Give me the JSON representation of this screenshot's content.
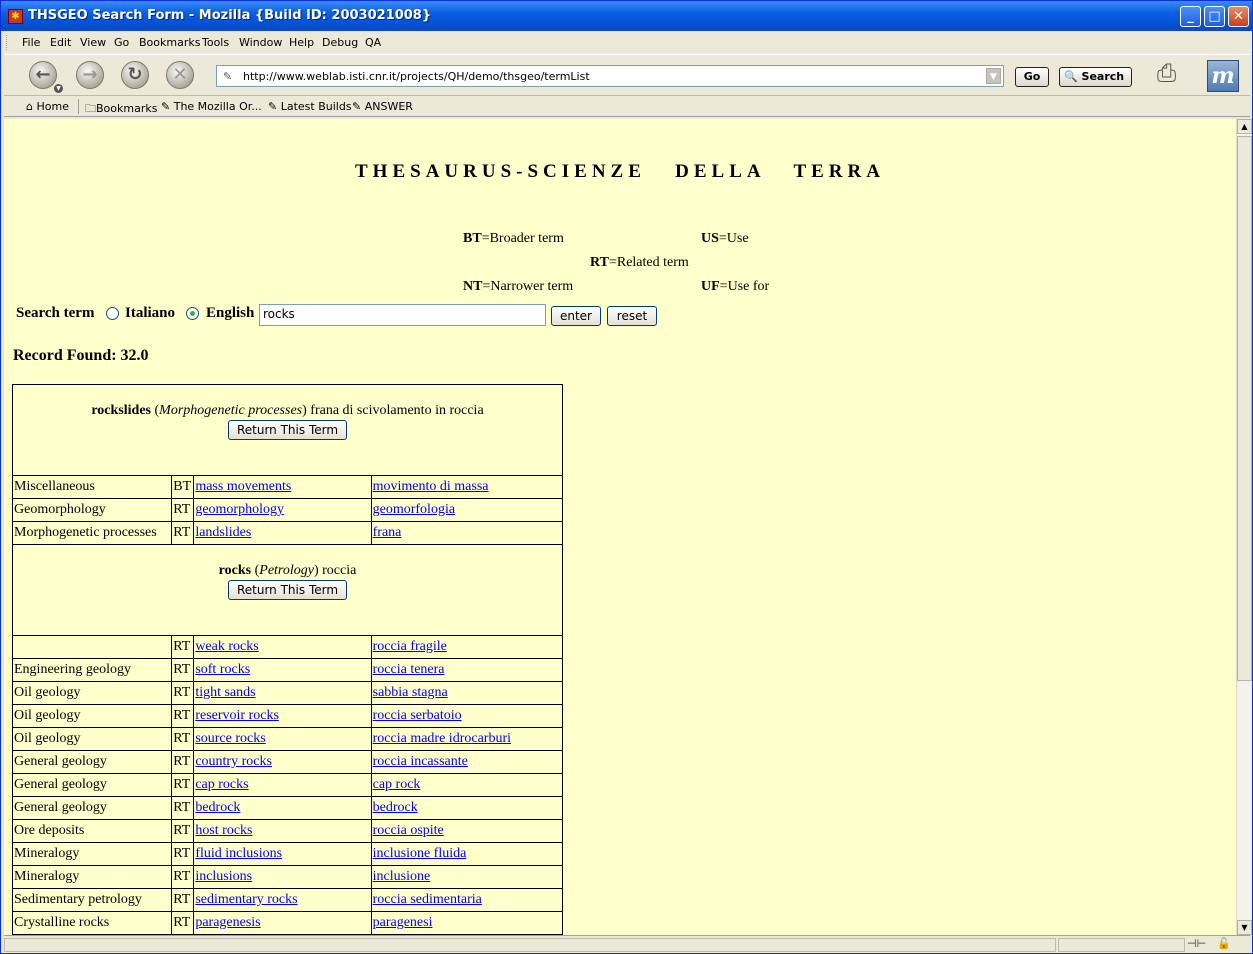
{
  "window": {
    "title": "THSGEO Search Form - Mozilla {Build ID: 2003021008}",
    "controls": [
      "minimize",
      "maximize",
      "close"
    ]
  },
  "menu": [
    "File",
    "Edit",
    "View",
    "Go",
    "Bookmarks",
    "Tools",
    "Window",
    "Help",
    "Debug",
    "QA"
  ],
  "navbar": {
    "url": "http://www.weblab.isti.cnr.it/projects/QH/demo/thsgeo/termList",
    "go_label": "Go",
    "search_label": "Search"
  },
  "bookmarks": [
    "Home",
    "Bookmarks",
    "The Mozilla Or...",
    "Latest Builds",
    "ANSWER"
  ],
  "page": {
    "title": "THESAURUS-SCIENZE   DELLA   TERRA",
    "legend": {
      "bt_abbr": "BT",
      "bt_text": "=Broader term",
      "us_abbr": "US",
      "us_text": "=Use",
      "rt_abbr": "RT",
      "rt_text": "=Related term",
      "nt_abbr": "NT",
      "nt_text": "=Narrower term",
      "uf_abbr": "UF",
      "uf_text": "=Use for"
    },
    "search": {
      "label": "Search term",
      "option_it": "Italiano",
      "option_en": "English",
      "selected": "English",
      "value": "rocks",
      "enter_label": "enter",
      "reset_label": "reset"
    },
    "record_found": "Record Found: 32.0",
    "return_label": "Return This Term",
    "groups": [
      {
        "term": "rockslides",
        "category": "Morphogenetic processes",
        "italian": "frana di scivolamento in roccia",
        "rows": [
          {
            "domain": "Miscellaneous",
            "rel": "BT",
            "en": "mass movements",
            "it": "movimento di massa"
          },
          {
            "domain": "Geomorphology",
            "rel": "RT",
            "en": "geomorphology",
            "it": "geomorfologia"
          },
          {
            "domain": "Morphogenetic processes",
            "rel": "RT",
            "en": "landslides",
            "it": "frana"
          }
        ]
      },
      {
        "term": "rocks",
        "category": "Petrology",
        "italian": "roccia",
        "rows": [
          {
            "domain": "",
            "rel": "RT",
            "en": "weak rocks",
            "it": "roccia fragile"
          },
          {
            "domain": "Engineering geology",
            "rel": "RT",
            "en": "soft rocks",
            "it": "roccia tenera"
          },
          {
            "domain": "Oil geology",
            "rel": "RT",
            "en": "tight sands",
            "it": "sabbia stagna"
          },
          {
            "domain": "Oil geology",
            "rel": "RT",
            "en": "reservoir rocks",
            "it": "roccia serbatoio"
          },
          {
            "domain": "Oil geology",
            "rel": "RT",
            "en": "source rocks",
            "it": "roccia madre idrocarburi"
          },
          {
            "domain": "General geology",
            "rel": "RT",
            "en": "country rocks",
            "it": "roccia incassante"
          },
          {
            "domain": "General geology",
            "rel": "RT",
            "en": "cap rocks",
            "it": "cap rock"
          },
          {
            "domain": "General geology",
            "rel": "RT",
            "en": "bedrock",
            "it": "bedrock"
          },
          {
            "domain": "Ore deposits",
            "rel": "RT",
            "en": "host rocks",
            "it": "roccia ospite"
          },
          {
            "domain": "Mineralogy",
            "rel": "RT",
            "en": "fluid inclusions",
            "it": "inclusione fluida"
          },
          {
            "domain": "Mineralogy",
            "rel": "RT",
            "en": "inclusions",
            "it": "inclusione"
          },
          {
            "domain": "Sedimentary petrology",
            "rel": "RT",
            "en": "sedimentary rocks",
            "it": "roccia sedimentaria"
          },
          {
            "domain": "Crystalline rocks",
            "rel": "RT",
            "en": "paragenesis",
            "it": "paragenesi"
          }
        ]
      }
    ]
  },
  "colors": {
    "page_background": "#ffffcc",
    "link": "#0000ee",
    "titlebar": "#0553d9"
  }
}
